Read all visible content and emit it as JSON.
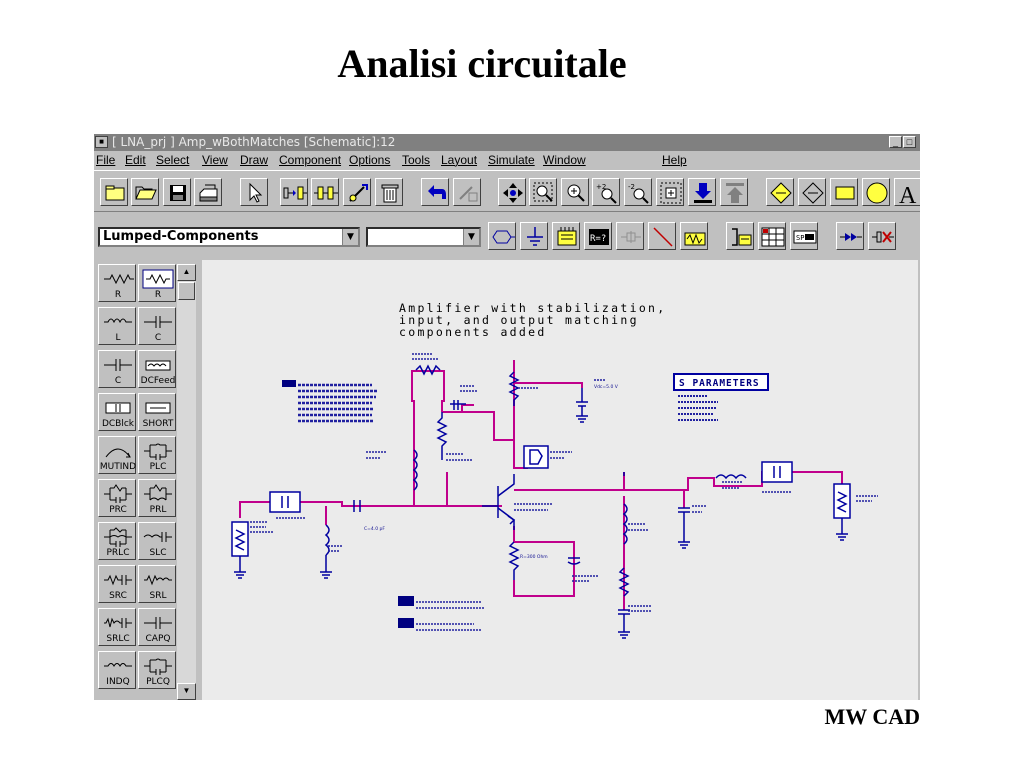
{
  "slide": {
    "title": "Analisi circuitale",
    "footer": "MW CAD"
  },
  "window": {
    "title": "[ LNA_prj ] Amp_wBothMatches [Schematic]:12",
    "min_btn": "_",
    "max_btn": "□"
  },
  "menu": {
    "file": "File",
    "edit": "Edit",
    "select": "Select",
    "view": "View",
    "draw": "Draw",
    "component": "Component",
    "options": "Options",
    "tools": "Tools",
    "layout": "Layout",
    "simulate": "Simulate",
    "window": "Window",
    "help": "Help"
  },
  "toolbar": {
    "library_combo": "Lumped-Components",
    "component_combo": "",
    "combo_arrow": "▼"
  },
  "palette": {
    "items": [
      {
        "label": "R",
        "icon": "resistor-icon"
      },
      {
        "label": "R",
        "icon": "resistor-box-icon"
      },
      {
        "label": "L",
        "icon": "inductor-icon"
      },
      {
        "label": "C",
        "icon": "capacitor-icon"
      },
      {
        "label": "C",
        "icon": "capacitor-icon"
      },
      {
        "label": "DCFeed",
        "icon": "dcfeed-icon"
      },
      {
        "label": "DCBlck",
        "icon": "dcblock-icon"
      },
      {
        "label": "SHORT",
        "icon": "short-icon"
      },
      {
        "label": "MUTIND",
        "icon": "mutual-inductor-icon"
      },
      {
        "label": "PLC",
        "icon": "plc-icon"
      },
      {
        "label": "PRC",
        "icon": "prc-icon"
      },
      {
        "label": "PRL",
        "icon": "prl-icon"
      },
      {
        "label": "PRLC",
        "icon": "prlc-icon"
      },
      {
        "label": "SLC",
        "icon": "slc-icon"
      },
      {
        "label": "SRC",
        "icon": "src-icon"
      },
      {
        "label": "SRL",
        "icon": "srl-icon"
      },
      {
        "label": "SRLC",
        "icon": "srlc-icon"
      },
      {
        "label": "CAPQ",
        "icon": "capq-icon"
      },
      {
        "label": "INDQ",
        "icon": "indq-icon"
      },
      {
        "label": "PLCQ",
        "icon": "plcq-icon"
      }
    ],
    "scroll_up": "▲",
    "scroll_down": "▼"
  },
  "schematic": {
    "note_lines": [
      "Amplifier with stabilization,",
      "input, and output matching",
      "components added"
    ],
    "sparam_box": "S PARAMETERS",
    "vdc_label": "Vdc=5.0 V",
    "cap_label": "C=4.0 pF",
    "res_label": "R=300 Ohm"
  },
  "colors": {
    "wire": "#c0008c",
    "component": "#0000a0",
    "canvas": "#ebebeb",
    "chrome": "#c0c0c0",
    "titlebar": "#808080"
  }
}
